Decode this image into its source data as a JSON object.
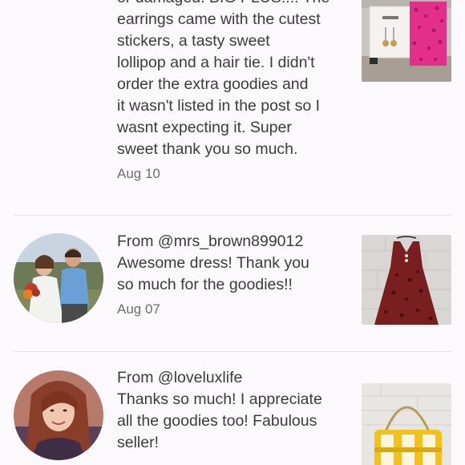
{
  "reviews": [
    {
      "from": "",
      "lines": [
        "or damaged. BIG PLUS!!!! The",
        "earrings came with the cutest",
        "stickers, a tasty sweet",
        "lollipop and a hair tie. I didn't",
        "order the extra goodies and",
        "it wasn't listed in the post so I",
        "wasnt expecting it. Super",
        "sweet thank you so much."
      ],
      "date": "Aug 10"
    },
    {
      "from": "From @mrs_brown899012",
      "lines": [
        "Awesome dress! Thank you",
        "so much for the goodies!!"
      ],
      "date": "Aug 07"
    },
    {
      "from": "From @loveluxlife",
      "lines": [
        "Thanks so much! I appreciate",
        "all the goodies too! Fabulous",
        "seller!"
      ],
      "date": ""
    }
  ],
  "colors": {
    "background": "#fbf9fb",
    "text": "#3c3c3c",
    "muted": "#6e6e6e",
    "divider": "#e6e4e6"
  }
}
